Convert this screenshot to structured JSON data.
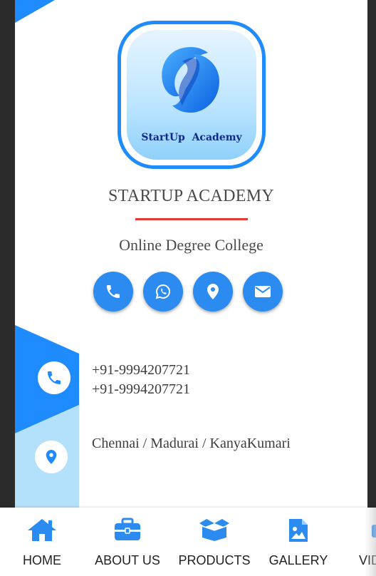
{
  "brand": {
    "logo_text": "StartUp  Academy",
    "name": "STARTUP ACADEMY",
    "tagline": "Online Degree College"
  },
  "quick_actions": [
    {
      "icon": "phone-icon"
    },
    {
      "icon": "whatsapp-icon"
    },
    {
      "icon": "location-pin-icon"
    },
    {
      "icon": "envelope-icon"
    }
  ],
  "contact": {
    "phones": [
      "+91-9994207721",
      "+91-9994207721"
    ],
    "address": "Chennai / Madurai / KanyaKumari"
  },
  "nav": {
    "items": [
      {
        "label": "HOME",
        "icon": "home-icon"
      },
      {
        "label": "ABOUT US",
        "icon": "briefcase-icon"
      },
      {
        "label": "PRODUCTS",
        "icon": "box-icon"
      },
      {
        "label": "GALLERY",
        "icon": "image-icon"
      },
      {
        "label": "VID",
        "icon": "video-icon"
      }
    ]
  },
  "colors": {
    "accent": "#2b8bf0",
    "light_accent": "#b3e0fb",
    "divider": "#e53935",
    "frame": "#2b2b2b"
  }
}
